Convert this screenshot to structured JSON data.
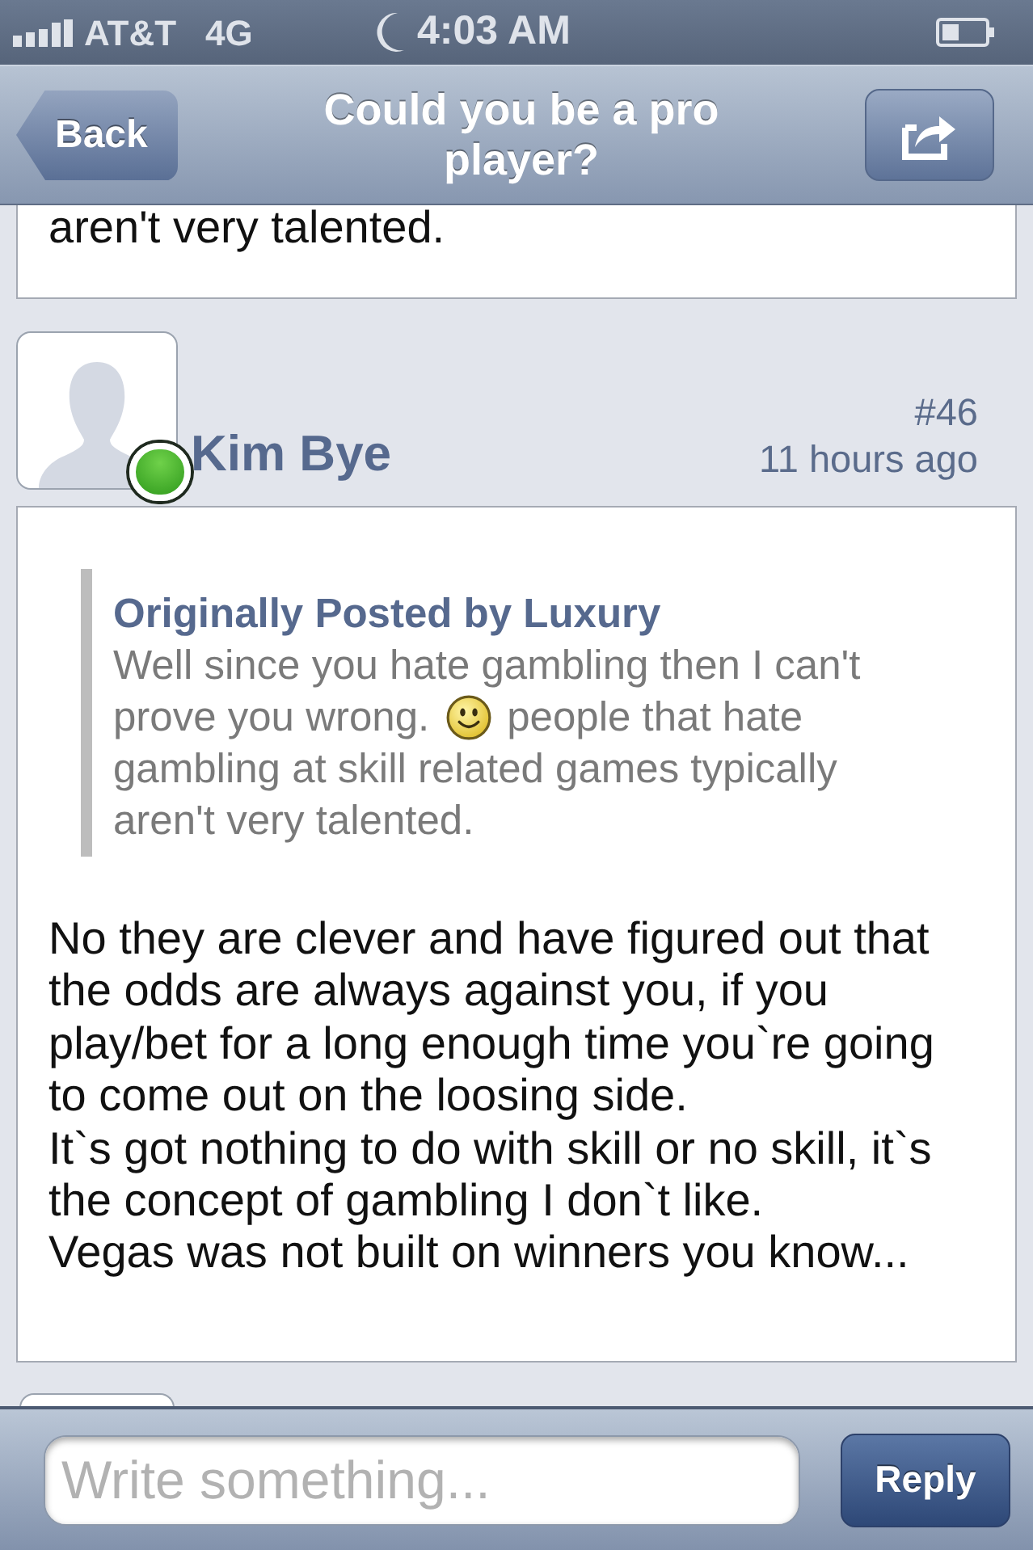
{
  "status_bar": {
    "carrier": "AT&T",
    "network": "4G",
    "time": "4:03 AM"
  },
  "nav_bar": {
    "back_label": "Back",
    "title": "Could you be a pro player?"
  },
  "previous_post": {
    "body_tail": "aren't very talented."
  },
  "post": {
    "author": {
      "name": "Kim Bye",
      "online": true
    },
    "number": "#46",
    "time": "11 hours ago",
    "quote": {
      "attribution": "Originally Posted by Luxury",
      "lines": [
        [
          {
            "kind": "text",
            "text": "Well since you hate gambling then I can't"
          }
        ],
        [
          {
            "kind": "text",
            "text": "prove you wrong."
          },
          {
            "kind": "emoticon"
          },
          {
            "kind": "text",
            "text": "people that hate"
          }
        ],
        [
          {
            "kind": "text",
            "text": "gambling at skill related games typically"
          }
        ],
        [
          {
            "kind": "text",
            "text": "aren't very talented."
          }
        ]
      ]
    },
    "body": [
      "No they are clever and have figured out that the odds are always against you, if you play/bet for a long enough time you`re going to come out on the loosing side.",
      "It`s got nothing to do with skill or no skill, it`s the concept of gambling I don`t like.",
      "Vegas was not built on winners you know..."
    ]
  },
  "composer": {
    "placeholder": "Write something...",
    "button_label": "Reply"
  }
}
